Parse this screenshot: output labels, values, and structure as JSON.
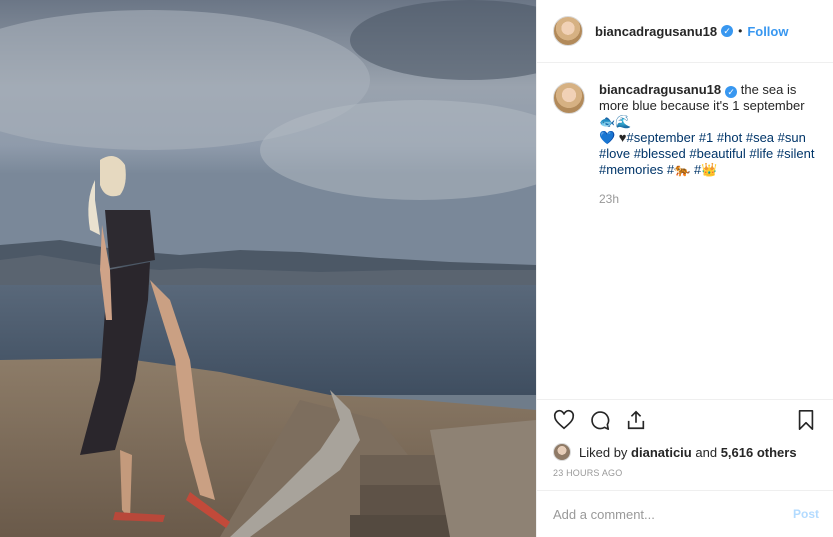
{
  "header": {
    "username": "biancadragusanu18",
    "separator": "•",
    "follow_label": "Follow",
    "verified_icon": "verified-badge-icon"
  },
  "caption": {
    "username": "biancadragusanu18",
    "text_start": "the sea is more blue because it's 1 september ",
    "emoji_1": "🐟🌊",
    "emoji_2": "💙 ♥",
    "hashtags_line1": [
      "#september",
      "#1",
      "#hot",
      "#sea",
      "#sun"
    ],
    "hashtags_line2": [
      "#love",
      "#blessed",
      "#beautiful",
      "#life",
      "#silent"
    ],
    "hashtags_line3_a": "#memories",
    "hashtags_line3_b": "#",
    "emoji_3": "🐅",
    "emoji_4": "👑",
    "time": "23h"
  },
  "actions": {
    "like_icon": "heart-icon",
    "comment_icon": "comment-icon",
    "share_icon": "share-icon",
    "save_icon": "bookmark-icon"
  },
  "likes": {
    "prefix": "Liked by",
    "user": "dianaticiu",
    "middle": "and",
    "count": "5,616 others"
  },
  "timestamp": "23 HOURS AGO",
  "add_comment": {
    "placeholder": "Add a comment...",
    "post_label": "Post"
  }
}
